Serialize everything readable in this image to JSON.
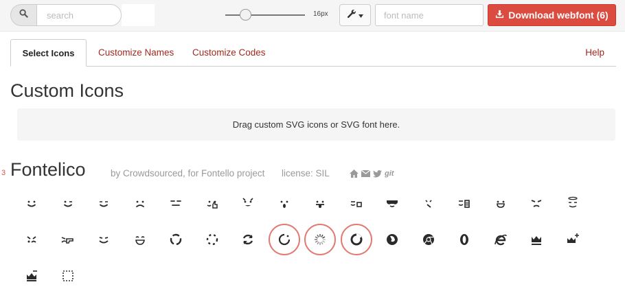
{
  "toolbar": {
    "search_placeholder": "search",
    "size_label": "16px",
    "font_name_placeholder": "font name",
    "download_label": "Download webfont (6)",
    "accent": "#db4b3f",
    "slider_level": 0.21
  },
  "tabs": [
    {
      "label": "Select Icons",
      "active": true
    },
    {
      "label": "Customize Names",
      "active": false
    },
    {
      "label": "Customize Codes",
      "active": false
    },
    {
      "label": "Help",
      "active": false
    }
  ],
  "custom": {
    "title": "Custom Icons",
    "dropzone": "Drag custom SVG icons or SVG font here."
  },
  "font": {
    "row_number": "3",
    "title": "Fontelico",
    "author": "by Crowdsourced, for Fontello project",
    "license": "license: SIL",
    "meta_icons": [
      "home-icon",
      "mail-icon",
      "twitter-icon",
      "git-icon"
    ],
    "git_text": "git"
  },
  "glyphs": [
    {
      "name": "emo-happy",
      "selected": false
    },
    {
      "name": "emo-wink",
      "selected": false
    },
    {
      "name": "emo-wink2",
      "selected": false
    },
    {
      "name": "emo-unhappy",
      "selected": false
    },
    {
      "name": "emo-sleep",
      "selected": false
    },
    {
      "name": "emo-thumbsup",
      "selected": false
    },
    {
      "name": "emo-devil",
      "selected": false
    },
    {
      "name": "emo-surprised",
      "selected": false
    },
    {
      "name": "emo-tongue",
      "selected": false
    },
    {
      "name": "emo-coffee",
      "selected": false
    },
    {
      "name": "emo-sunglasses",
      "selected": false
    },
    {
      "name": "emo-displeased",
      "selected": false
    },
    {
      "name": "emo-beer",
      "selected": false
    },
    {
      "name": "emo-grin",
      "selected": false
    },
    {
      "name": "emo-angry",
      "selected": false
    },
    {
      "name": "emo-saint",
      "selected": false
    },
    {
      "name": "emo-cry",
      "selected": false
    },
    {
      "name": "emo-shoot",
      "selected": false
    },
    {
      "name": "emo-squint",
      "selected": false
    },
    {
      "name": "emo-laugh",
      "selected": false
    },
    {
      "name": "spin1",
      "selected": false
    },
    {
      "name": "spin2",
      "selected": false
    },
    {
      "name": "spin3",
      "selected": false
    },
    {
      "name": "spin4",
      "selected": true
    },
    {
      "name": "spin5",
      "selected": true
    },
    {
      "name": "spin6",
      "selected": true
    },
    {
      "name": "firefox",
      "selected": false
    },
    {
      "name": "chrome",
      "selected": false
    },
    {
      "name": "opera",
      "selected": false
    },
    {
      "name": "ie",
      "selected": false
    },
    {
      "name": "crown",
      "selected": false
    },
    {
      "name": "crown-plus",
      "selected": false
    },
    {
      "name": "crown-minus",
      "selected": false
    },
    {
      "name": "marquee",
      "selected": false
    }
  ]
}
